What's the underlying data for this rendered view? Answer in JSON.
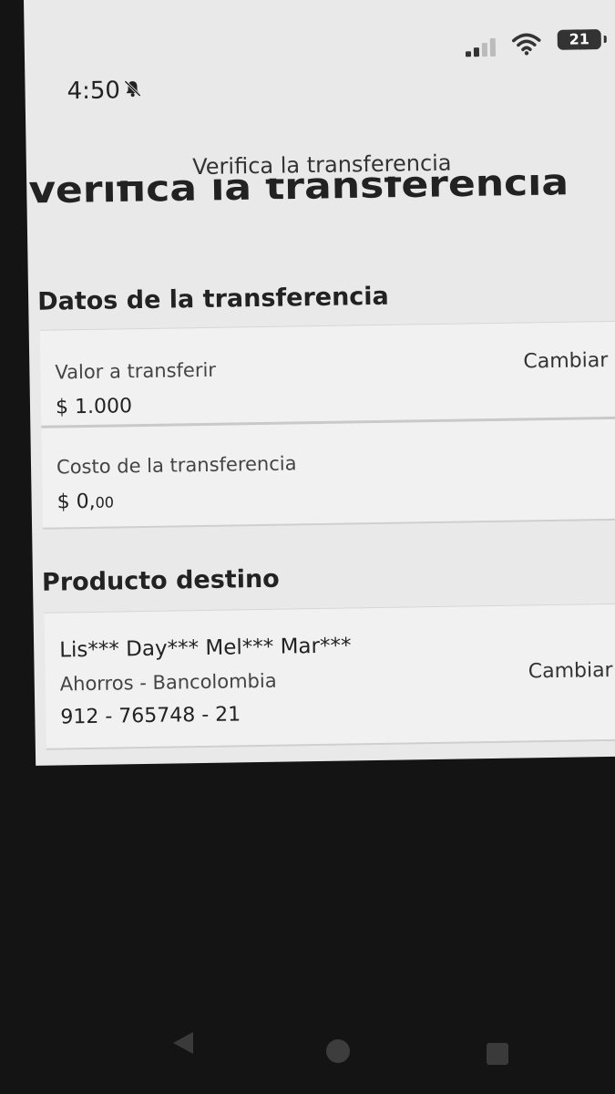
{
  "status_bar": {
    "time": "4:50",
    "battery": "21",
    "icons": [
      "bell-slash-icon",
      "signal-icon",
      "wifi-icon",
      "battery-icon"
    ]
  },
  "header": {
    "nav_title": "Verifica la transferencia",
    "large_title": "Verifica la transferencia"
  },
  "transfer_section": {
    "title": "Datos de la transferencia",
    "amount_label": "Valor a transferir",
    "amount_value": "$ 1.000",
    "change_label": "Cambiar",
    "cost_label": "Costo de la transferencia",
    "cost_value_main": "$ 0,",
    "cost_value_cents": "00"
  },
  "destination_section": {
    "title": "Producto destino",
    "holder_name": "Lis*** Day*** Mel*** Mar***",
    "account_type": "Ahorros - Bancolombia",
    "account_number": "912 - 765748 - 21",
    "change_label": "Cambiar"
  },
  "system_nav": {
    "icons": [
      "back-icon",
      "home-icon",
      "recent-apps-icon"
    ]
  }
}
